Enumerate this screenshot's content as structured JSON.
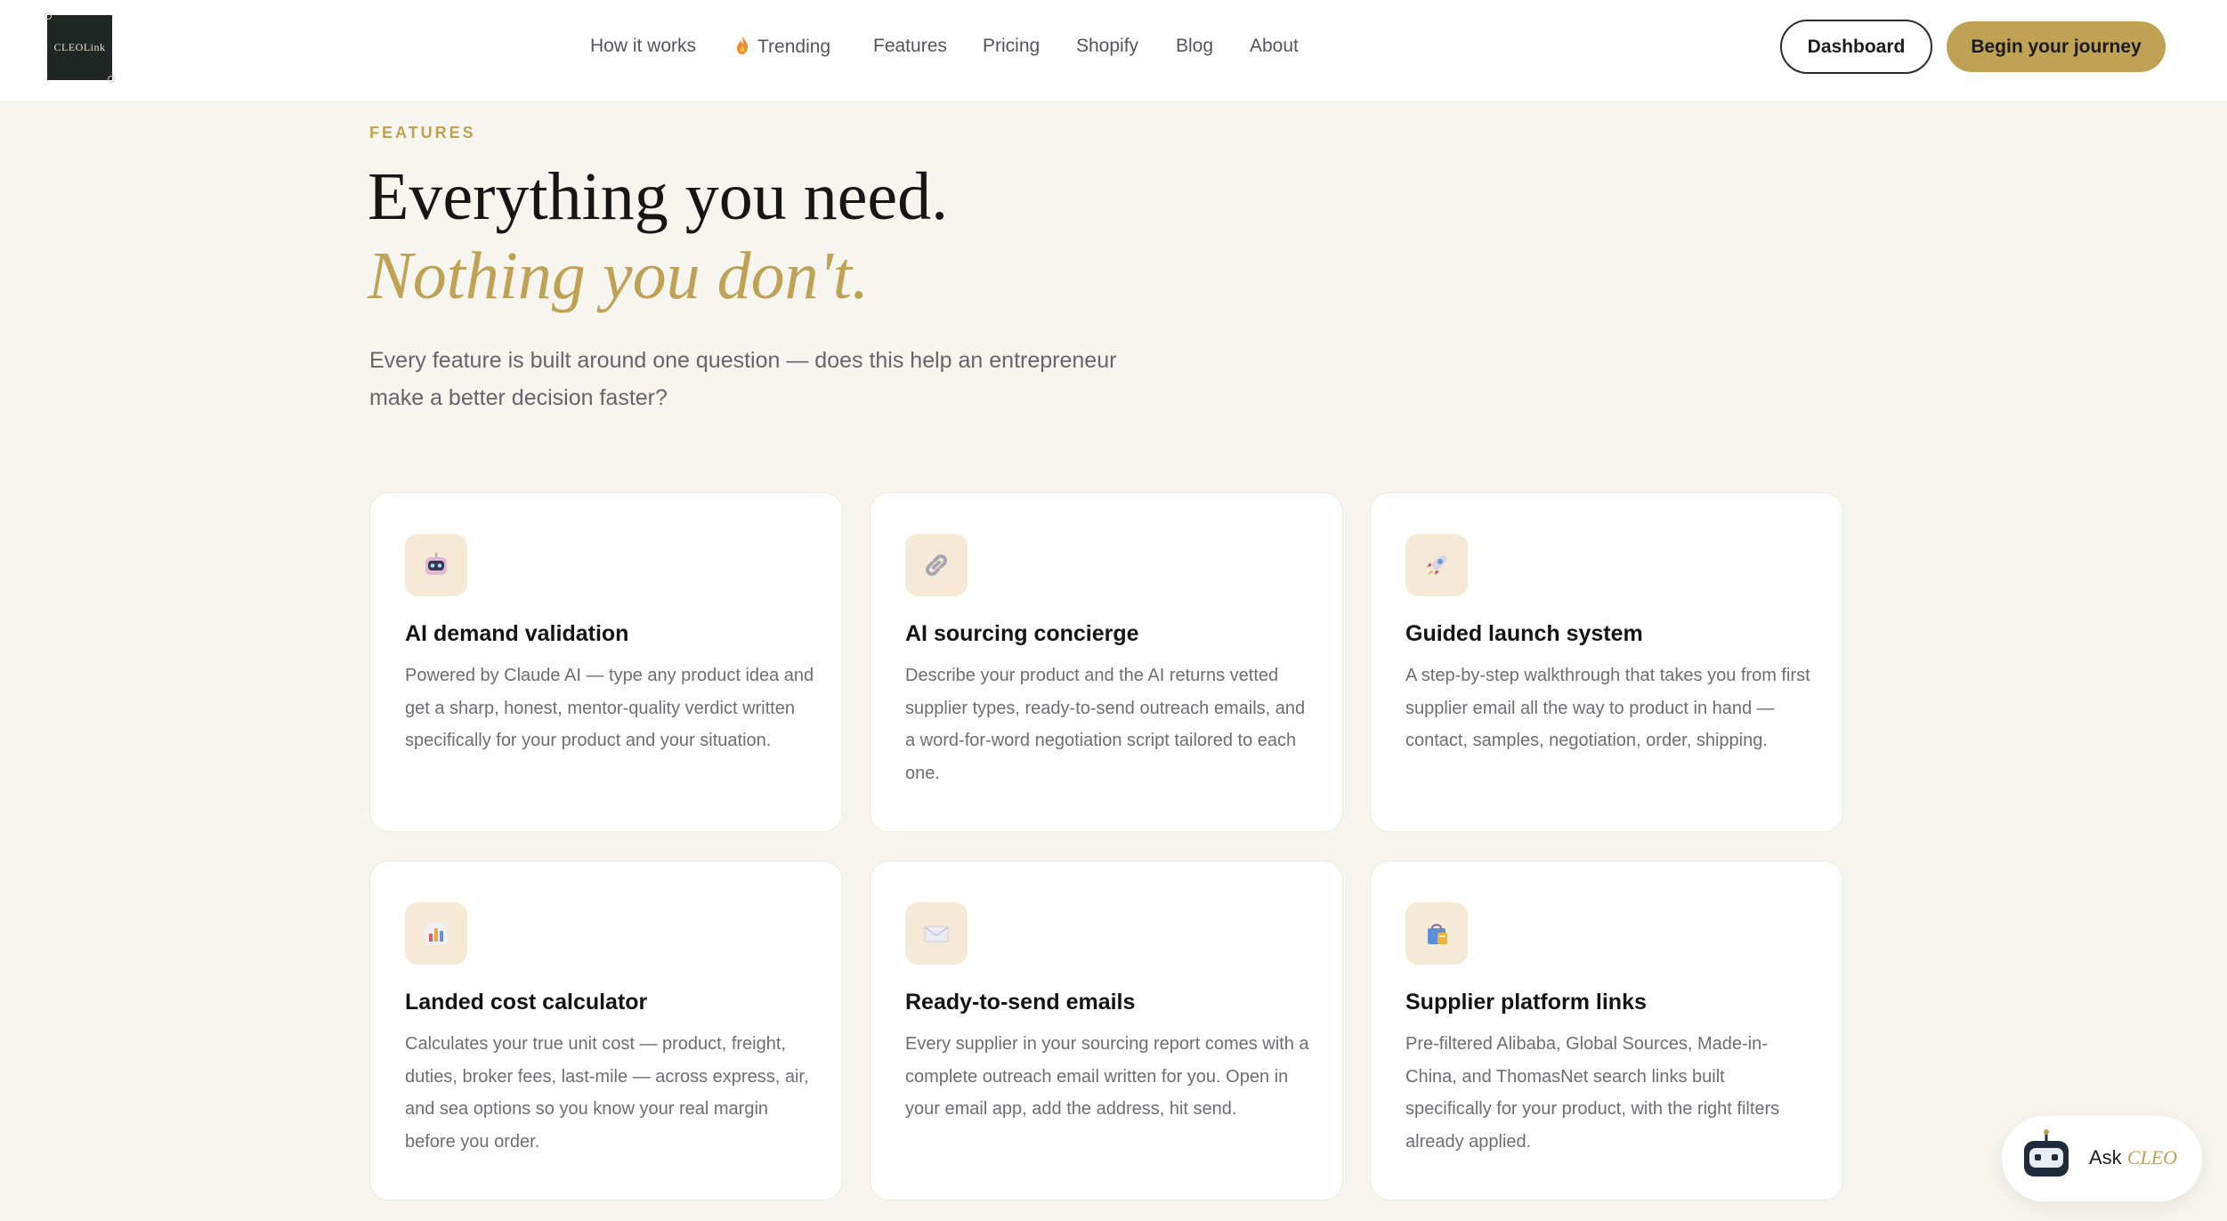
{
  "header": {
    "logo_text": "CLEOLink",
    "nav": [
      {
        "label": "How it works"
      },
      {
        "label": "Trending",
        "icon": "flame-icon"
      },
      {
        "label": "Features"
      },
      {
        "label": "Pricing"
      },
      {
        "label": "Shopify"
      },
      {
        "label": "Blog"
      },
      {
        "label": "About"
      }
    ],
    "dashboard_label": "Dashboard",
    "cta_label": "Begin your journey"
  },
  "hero": {
    "eyebrow": "FEATURES",
    "title_line1": "Everything you need.",
    "title_line2": "Nothing you don't.",
    "lede": "Every feature is built around one question — does this help an entrepreneur make a better decision faster?"
  },
  "features": [
    {
      "icon": "robot-icon",
      "title": "AI demand validation",
      "desc": "Powered by Claude AI — type any product idea and get a sharp, honest, mentor-quality verdict written specifically for your product and your situation."
    },
    {
      "icon": "link-icon",
      "title": "AI sourcing concierge",
      "desc": "Describe your product and the AI returns vetted supplier types, ready-to-send outreach emails, and a word-for-word negotiation script tailored to each one."
    },
    {
      "icon": "rocket-icon",
      "title": "Guided launch system",
      "desc": "A step-by-step walkthrough that takes you from first supplier email all the way to product in hand — contact, samples, negotiation, order, shipping."
    },
    {
      "icon": "bar-chart-icon",
      "title": "Landed cost calculator",
      "desc": "Calculates your true unit cost — product, freight, duties, broker fees, last-mile — across express, air, and sea options so you know your real margin before you order."
    },
    {
      "icon": "envelope-icon",
      "title": "Ready-to-send emails",
      "desc": "Every supplier in your sourcing report comes with a complete outreach email written for you. Open in your email app, add the address, hit send."
    },
    {
      "icon": "shopping-bag-icon",
      "title": "Supplier platform links",
      "desc": "Pre-filtered Alibaba, Global Sources, Made-in-China, and ThomasNet search links built specifically for your product, with the right filters already applied."
    }
  ],
  "ask_widget": {
    "prefix": "Ask",
    "brand": "CLEO"
  },
  "colors": {
    "accent_gold": "#c0a254",
    "page_bg": "#f6f5f0",
    "icon_tile_bg": "#f4ead6"
  }
}
